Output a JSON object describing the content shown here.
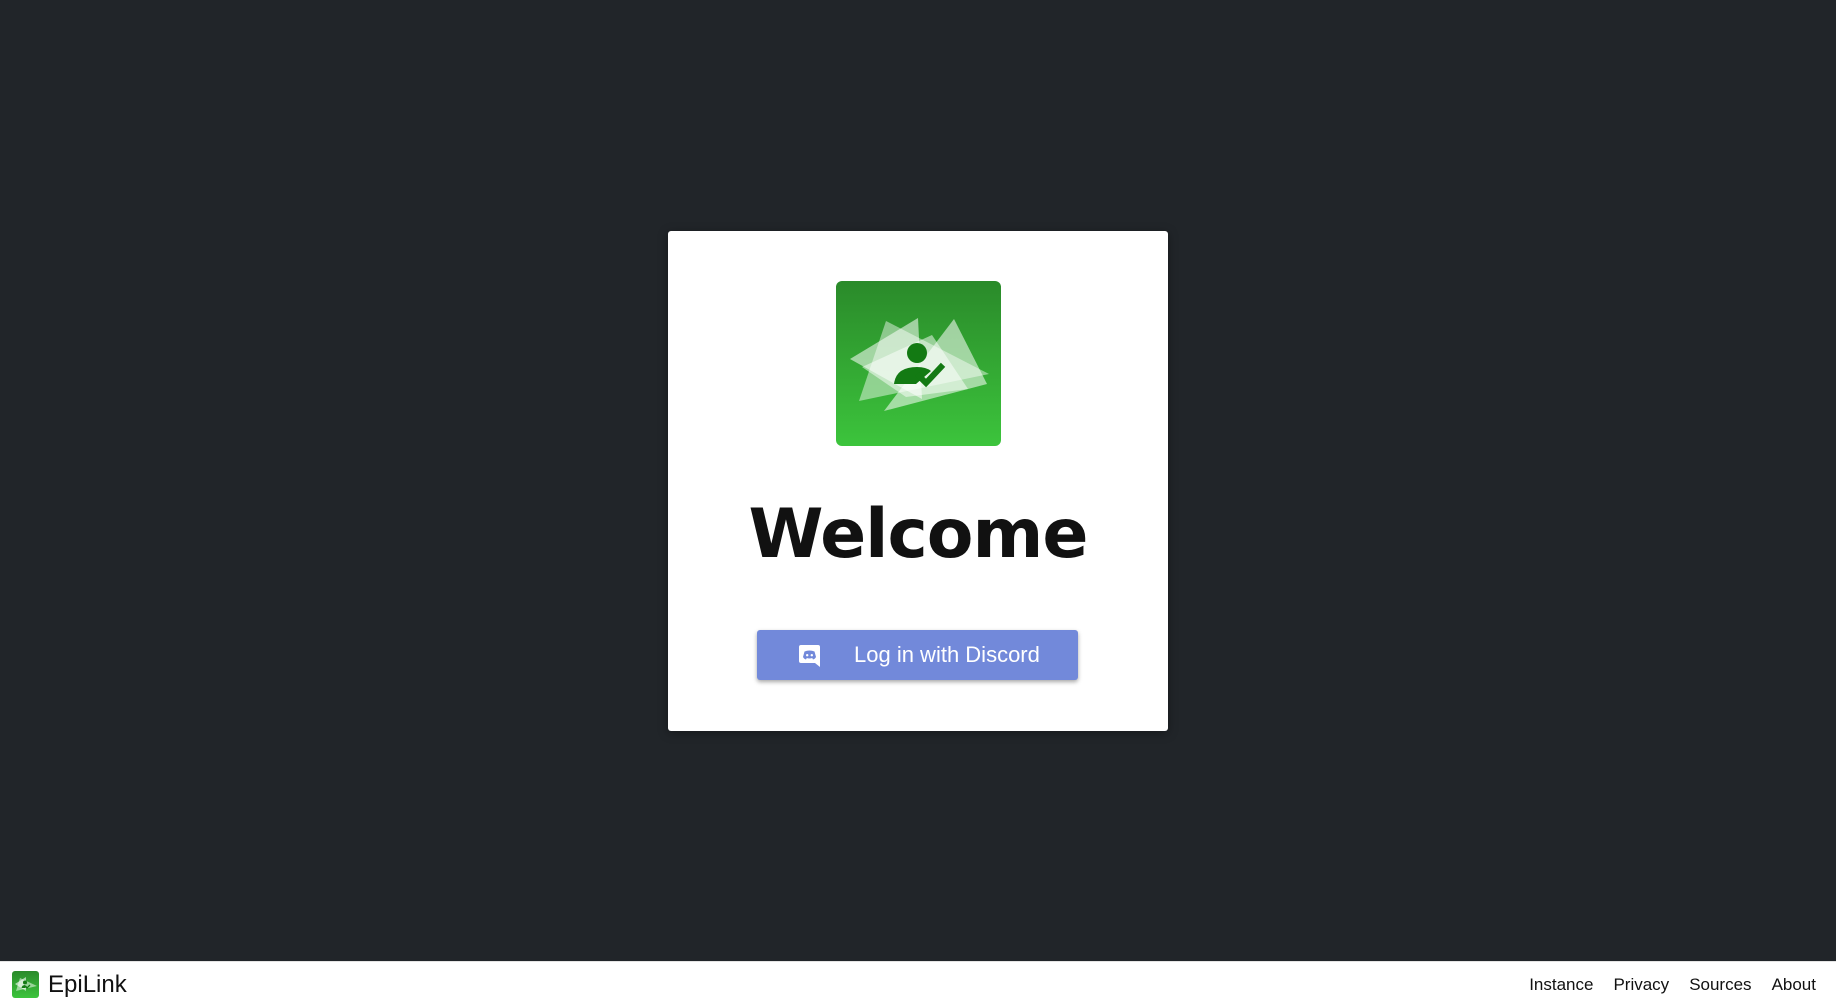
{
  "app": {
    "brand_name": "EpiLink"
  },
  "login_card": {
    "logo_icon": "epilink-logo-icon",
    "heading": "Welcome",
    "discord_button": {
      "label": "Log in with Discord",
      "icon": "discord-icon",
      "color": "#7289da"
    }
  },
  "footer": {
    "links": [
      {
        "label": "Instance"
      },
      {
        "label": "Privacy"
      },
      {
        "label": "Sources"
      },
      {
        "label": "About"
      }
    ]
  },
  "colors": {
    "background": "#212529",
    "card": "#ffffff",
    "brand_green_top": "#2a8a2a",
    "brand_green_bottom": "#3cc43c",
    "discord_blurple": "#7289da"
  }
}
